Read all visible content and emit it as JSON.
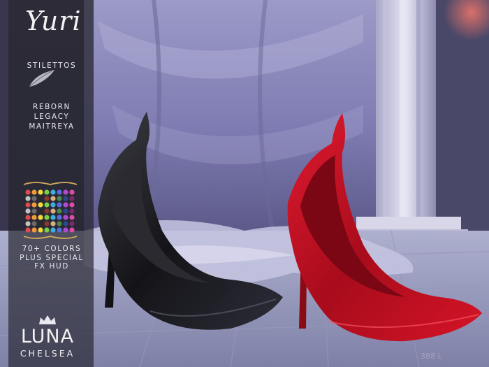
{
  "product": {
    "title": "Yuri",
    "type_label": "STILETTOS",
    "bodies": [
      "REBORN",
      "LEGACY",
      "MAITREYA"
    ],
    "colors_lines": [
      "70+ COLORS",
      "PLUS SPECIAL",
      "FX HUD"
    ]
  },
  "brand": {
    "name": "LUNA",
    "sub": "CHELSEA"
  },
  "watermark": "388 L",
  "palette_swatches": [
    "#e04a4a",
    "#f29a3a",
    "#f2d83a",
    "#7ad04a",
    "#3ab0e0",
    "#5a6ae0",
    "#b04ad0",
    "#e04aa8",
    "#c2c2c2",
    "#6a6a6a",
    "#2a2a2a",
    "#8a3a2a",
    "#d8b080",
    "#4a8a4a",
    "#2a4a8a",
    "#7a2a6a"
  ]
}
